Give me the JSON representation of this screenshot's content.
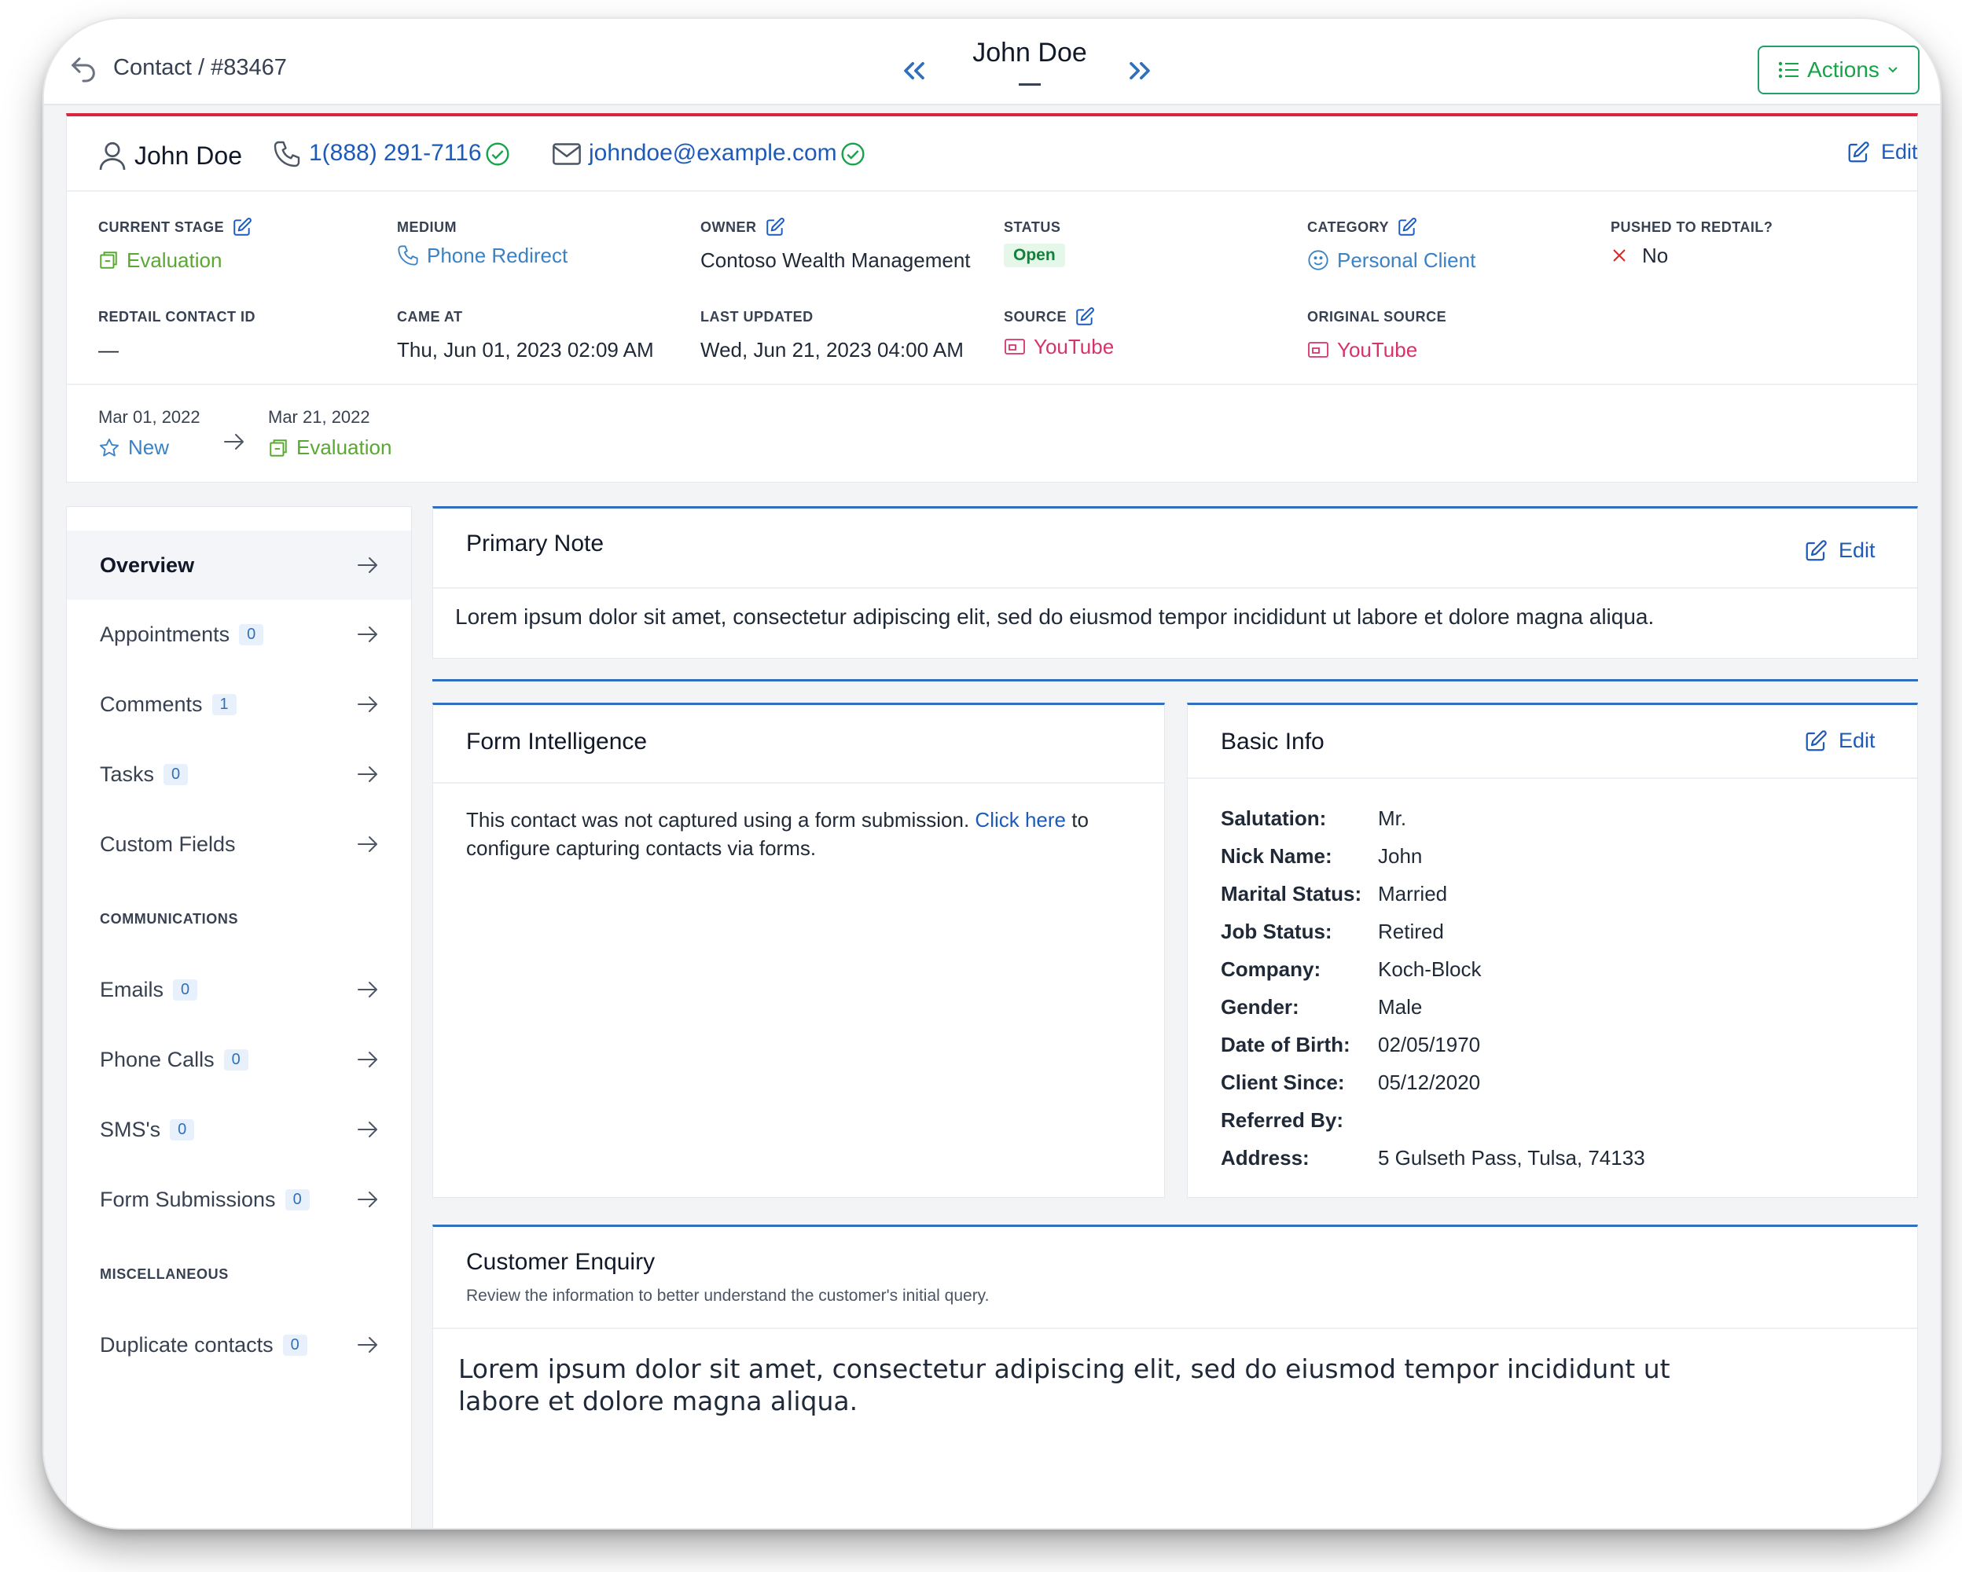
{
  "topbar": {
    "breadcrumb": "Contact / #83467",
    "title": "John Doe",
    "actions_label": "Actions"
  },
  "contact": {
    "name": "John Doe",
    "phone": "1(888) 291-7116",
    "email": "johndoe@example.com",
    "edit_label": "Edit"
  },
  "fields": {
    "current_stage": {
      "label": "CURRENT STAGE",
      "value": "Evaluation"
    },
    "medium": {
      "label": "MEDIUM",
      "value": "Phone Redirect"
    },
    "owner": {
      "label": "OWNER",
      "value": "Contoso Wealth Management"
    },
    "status": {
      "label": "STATUS",
      "value": "Open"
    },
    "category": {
      "label": "CATEGORY",
      "value": "Personal Client"
    },
    "pushed": {
      "label": "PUSHED TO REDTAIL?",
      "value": "No"
    },
    "redtail_id": {
      "label": "REDTAIL CONTACT ID",
      "value": "—"
    },
    "came_at": {
      "label": "CAME AT",
      "value": "Thu, Jun 01, 2023 02:09 AM"
    },
    "last_updated": {
      "label": "LAST UPDATED",
      "value": "Wed, Jun 21, 2023 04:00 AM"
    },
    "source": {
      "label": "SOURCE",
      "value": "YouTube"
    },
    "original_source": {
      "label": "ORIGINAL SOURCE",
      "value": "YouTube"
    }
  },
  "history": [
    {
      "date": "Mar 01, 2022",
      "stage": "New"
    },
    {
      "date": "Mar 21, 2022",
      "stage": "Evaluation"
    }
  ],
  "sidebar": {
    "items": [
      {
        "label": "Overview"
      },
      {
        "label": "Appointments",
        "count": "0"
      },
      {
        "label": "Comments",
        "count": "1"
      },
      {
        "label": "Tasks",
        "count": "0"
      },
      {
        "label": "Custom Fields"
      }
    ],
    "communications_title": "COMMUNICATIONS",
    "communications": [
      {
        "label": "Emails",
        "count": "0"
      },
      {
        "label": "Phone Calls",
        "count": "0"
      },
      {
        "label": "SMS's",
        "count": "0"
      },
      {
        "label": "Form Submissions",
        "count": "0"
      }
    ],
    "misc_title": "MISCELLANEOUS",
    "misc": [
      {
        "label": "Duplicate contacts",
        "count": "0"
      }
    ]
  },
  "primary_note": {
    "title": "Primary Note",
    "edit_label": "Edit",
    "text": "Lorem ipsum dolor sit amet, consectetur adipiscing elit, sed do eiusmod tempor incididunt ut labore et dolore magna aliqua."
  },
  "form_intelligence": {
    "title": "Form Intelligence",
    "text_before": "This contact was not captured using a form submission. ",
    "link": "Click here",
    "text_after": " to",
    "text_line2": "configure capturing contacts via forms."
  },
  "basic_info": {
    "title": "Basic Info",
    "edit_label": "Edit",
    "rows": [
      {
        "label": "Salutation:",
        "value": "Mr."
      },
      {
        "label": "Nick Name:",
        "value": "John"
      },
      {
        "label": "Marital Status:",
        "value": "Married"
      },
      {
        "label": "Job Status:",
        "value": "Retired"
      },
      {
        "label": "Company:",
        "value": "Koch-Block"
      },
      {
        "label": "Gender:",
        "value": "Male"
      },
      {
        "label": "Date of Birth:",
        "value": "02/05/1970"
      },
      {
        "label": "Client Since:",
        "value": "05/12/2020"
      },
      {
        "label": "Referred By:",
        "value": ""
      },
      {
        "label": "Address:",
        "value": "5 Gulseth Pass, Tulsa, 74133"
      }
    ]
  },
  "customer_enquiry": {
    "title": "Customer Enquiry",
    "subtitle": "Review the information to better understand the customer's initial query.",
    "text_line1": "Lorem ipsum dolor sit amet, consectetur adipiscing elit, sed do eiusmod tempor incididunt ut",
    "text_line2": "labore et dolore magna aliqua."
  },
  "colors": {
    "accent_blue": "#2f6fbd",
    "link_blue": "#1e5bb8",
    "green": "#16a34a",
    "header_red": "#d7263d",
    "source_pink": "#d6336c"
  }
}
